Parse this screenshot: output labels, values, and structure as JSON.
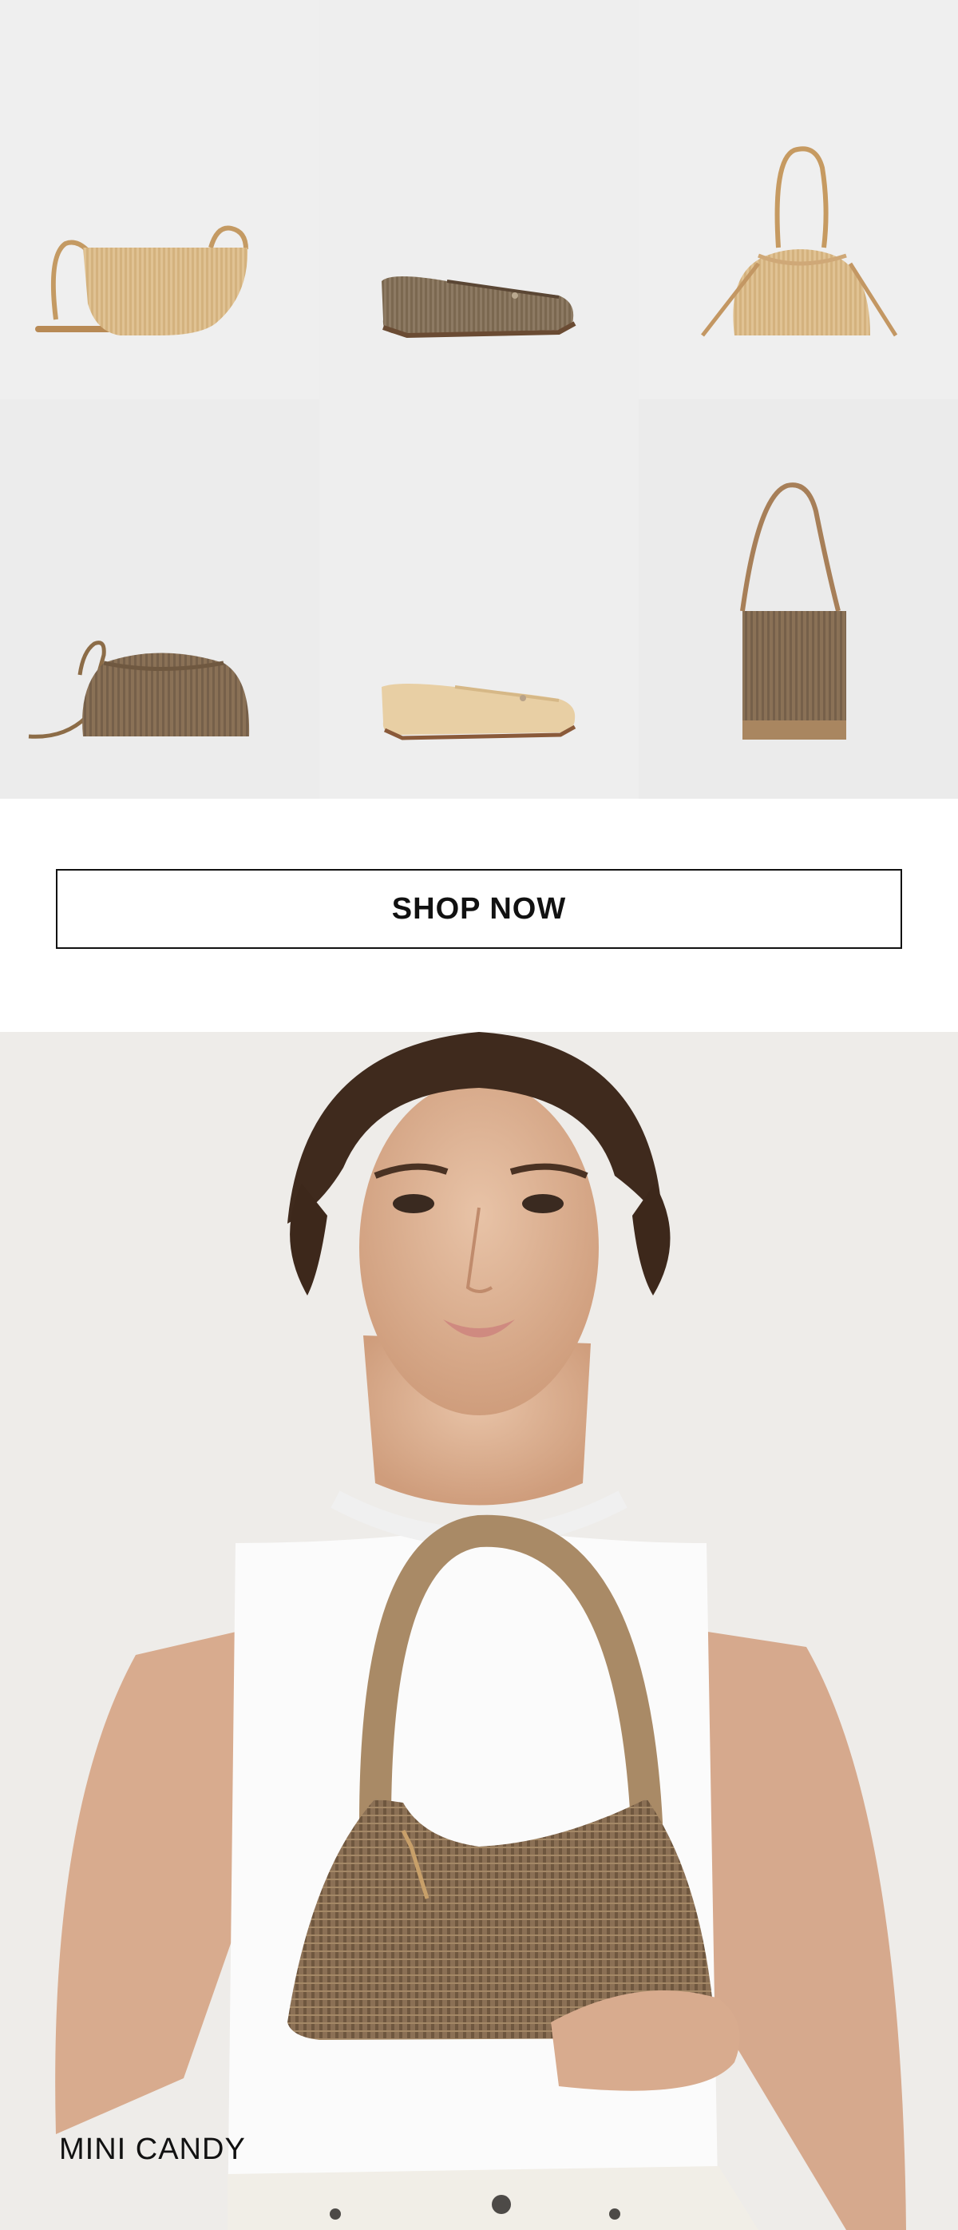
{
  "products": [
    {
      "name": "raffia half moon crossbody bag",
      "color": "#e0c293"
    },
    {
      "name": "woven ballet flat",
      "color": "#8d7a63"
    },
    {
      "name": "raffia drawstring bucket bag",
      "color": "#e2c596"
    },
    {
      "name": "woven cloud clutch",
      "color": "#8a7156"
    },
    {
      "name": "natural raffia ballet flat",
      "color": "#e8cfa4"
    },
    {
      "name": "woven tote with suede base",
      "color": "#88705a"
    }
  ],
  "cta": {
    "label": "SHOP NOW"
  },
  "hero": {
    "caption": "MINI CANDY",
    "bag_color": "#8b7055",
    "handle_color": "#a98a66"
  }
}
